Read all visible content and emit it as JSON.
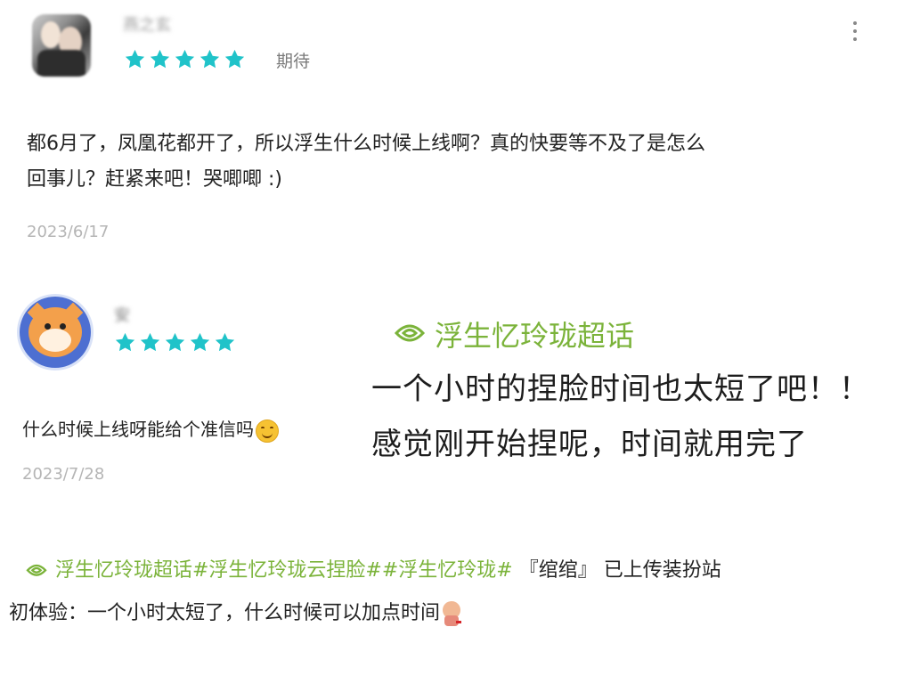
{
  "reviews": [
    {
      "username": "燕之玄",
      "rating": 5,
      "rating_label": "期待",
      "content_lines": [
        "都6月了，凤凰花都开了，所以浮生什么时候上线啊？真的快要等不及了是怎么",
        "回事儿？赶紧来吧！哭唧唧 :)"
      ],
      "date": "2023/6/17"
    },
    {
      "username": "安",
      "rating": 5,
      "content": "什么时候上线呀能给个准信吗",
      "emoji": "smiling-face-emoji",
      "date": "2023/7/28"
    }
  ],
  "overlay_post": {
    "topic": "浮生忆玲珑超话",
    "lines": [
      "一个小时的捏脸时间也太短了吧！！",
      "感觉刚开始捏呢，时间就用完了"
    ]
  },
  "bottom_post": {
    "tags": "浮生忆玲珑超话#浮生忆玲珑云捏脸##浮生忆玲珑#",
    "line1_rest": "『绾绾』 已上传装扮站",
    "line2": "初体验：一个小时太短了，什么时候可以加点时间",
    "sticker": "crying-character-sticker"
  },
  "colors": {
    "star": "#20c3c9",
    "topic_green": "#7bb33a",
    "date_gray": "#b5b5b5",
    "avatar2_ring": "#4d6fd1"
  },
  "icons": {
    "menu": "more-vertical-icon",
    "topic": "super-topic-icon"
  }
}
